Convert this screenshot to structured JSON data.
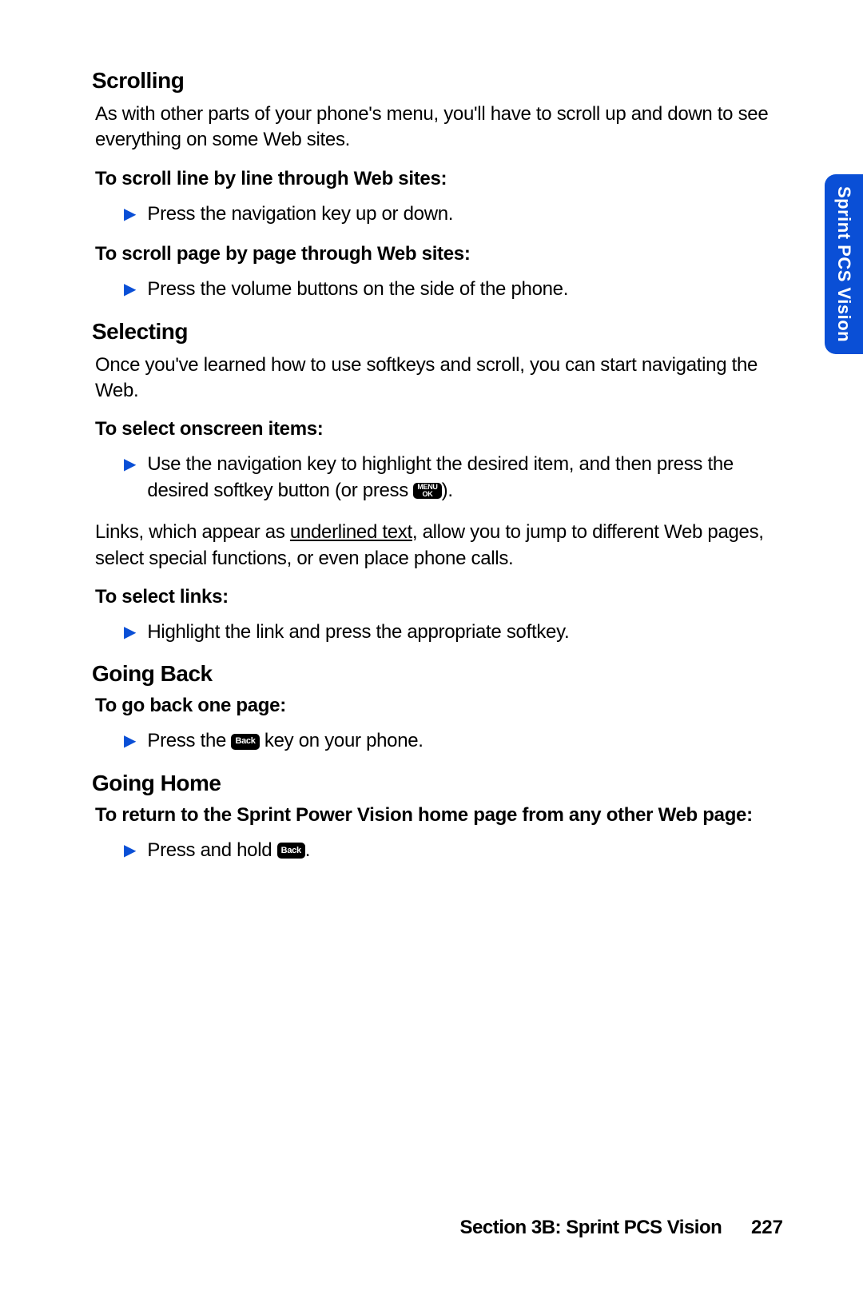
{
  "side_tab": "Sprint PCS Vision",
  "sections": {
    "scrolling": {
      "heading": "Scrolling",
      "intro": "As with other parts of your phone's menu, you'll have to scroll up and down to see everything on some Web sites.",
      "instr1": "To scroll line by line through Web sites:",
      "bullet1": "Press the navigation key up or down.",
      "instr2": "To scroll page by page through Web sites:",
      "bullet2": "Press the volume buttons on the side of the phone."
    },
    "selecting": {
      "heading": "Selecting",
      "intro": "Once you've learned how to use softkeys and scroll, you can start navigating the Web.",
      "instr1": "To select onscreen items:",
      "bullet1a": "Use the navigation key to highlight the desired item, and then press the desired softkey button (or press ",
      "bullet1b": ").",
      "links_a": "Links, which appear as ",
      "links_u": "underlined text",
      "links_b": ", allow you to jump to different Web pages, select special functions, or even place phone calls.",
      "instr2": "To select links:",
      "bullet2": "Highlight the link and press the appropriate softkey."
    },
    "going_back": {
      "heading": "Going Back",
      "instr": "To go back one page:",
      "bullet_a": "Press the ",
      "bullet_b": " key on your phone."
    },
    "going_home": {
      "heading": "Going Home",
      "instr": "To return to the Sprint Power Vision home page from any other Web page:",
      "bullet_a": "Press and hold ",
      "bullet_b": "."
    }
  },
  "keys": {
    "menu_ok_top": "MENU",
    "menu_ok_bot": "OK",
    "back": "Back"
  },
  "footer": {
    "section": "Section 3B: Sprint PCS Vision",
    "page": "227"
  }
}
